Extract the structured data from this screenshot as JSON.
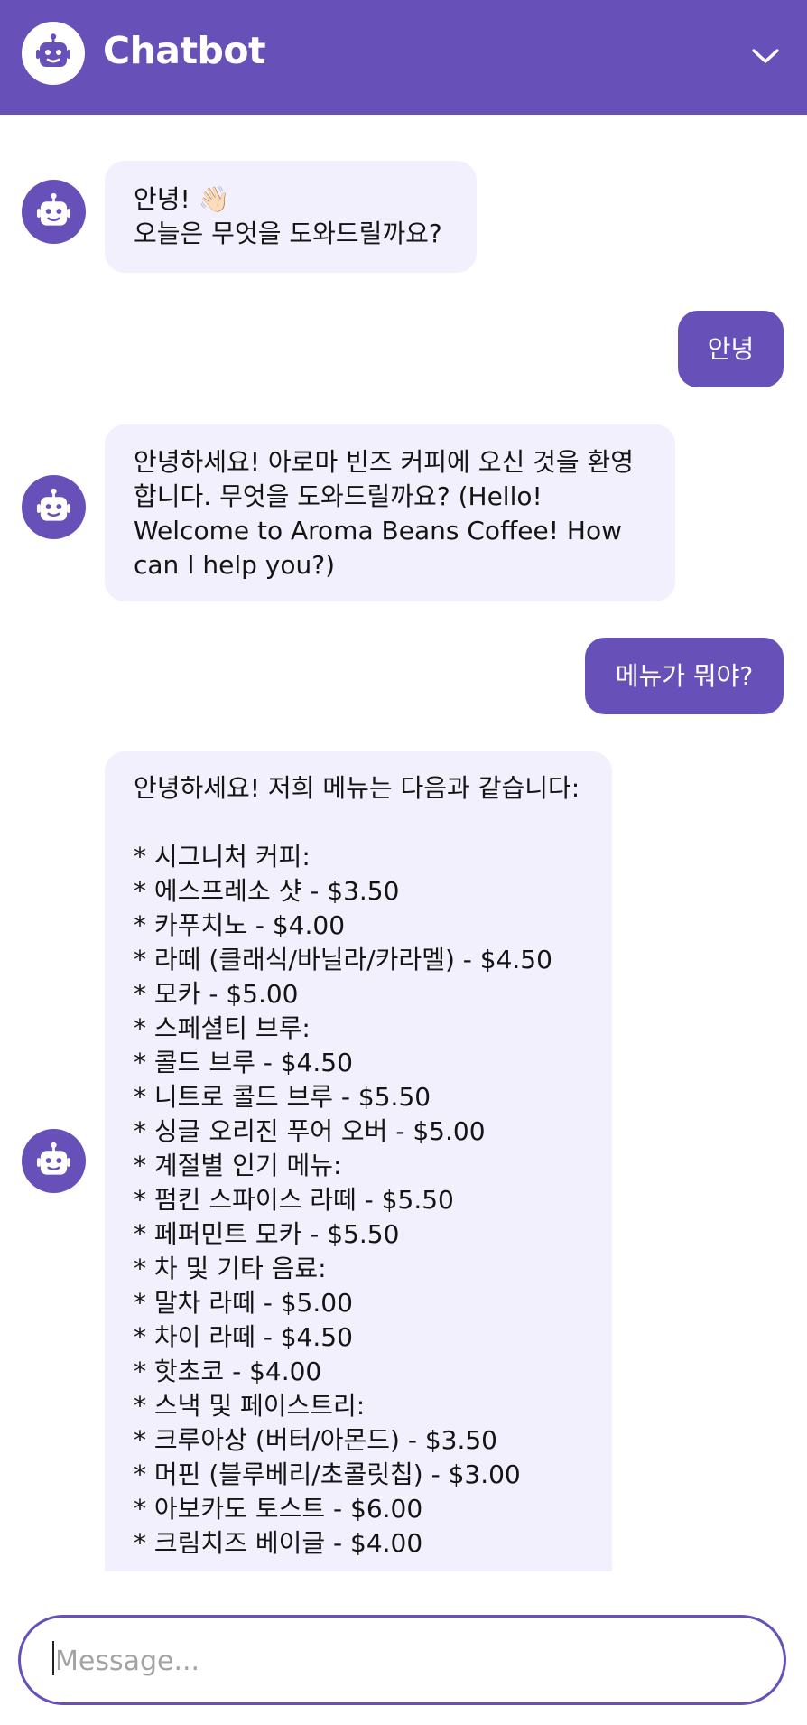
{
  "header": {
    "title": "Chatbot",
    "avatar_icon": "robot-icon",
    "toggle_icon": "chevron-down-icon"
  },
  "colors": {
    "accent": "#6750b8",
    "bot_bubble": "#f3f0fd",
    "user_text": "#ffffff"
  },
  "messages": [
    {
      "role": "bot",
      "text": "안녕! 👋🏻\n오늘은 무엇을 도와드릴까요?"
    },
    {
      "role": "user",
      "text": "안녕"
    },
    {
      "role": "bot",
      "text": "안녕하세요! 아로마 빈즈 커피에 오신 것을 환영\n합니다. 무엇을 도와드릴까요? (Hello!\nWelcome to Aroma Beans Coffee! How\ncan I help you?)"
    },
    {
      "role": "user",
      "text": "메뉴가 뭐야?"
    },
    {
      "role": "bot",
      "text": "안녕하세요! 저희 메뉴는 다음과 같습니다:\n\n* 시그니처 커피:\n* 에스프레소 샷 - $3.50\n* 카푸치노 - $4.00\n* 라떼 (클래식/바닐라/카라멜) - $4.50\n* 모카 - $5.00\n* 스페셜티 브루:\n* 콜드 브루 - $4.50\n* 니트로 콜드 브루 - $5.50\n* 싱글 오리진 푸어 오버 - $5.00\n* 계절별 인기 메뉴:\n* 펌킨 스파이스 라떼 - $5.50\n* 페퍼민트 모카 - $5.50\n* 차 및 기타 음료:\n* 말차 라떼 - $5.00\n* 차이 라떼 - $4.50\n* 핫초코 - $4.00\n* 스낵 및 페이스트리:\n* 크루아상 (버터/아몬드) - $3.50\n* 머핀 (블루베리/초콜릿칩) - $3.00\n* 아보카도 토스트 - $6.00\n* 크림치즈 베이글 - $4.00"
    }
  ],
  "composer": {
    "placeholder": "Message...",
    "value": ""
  }
}
